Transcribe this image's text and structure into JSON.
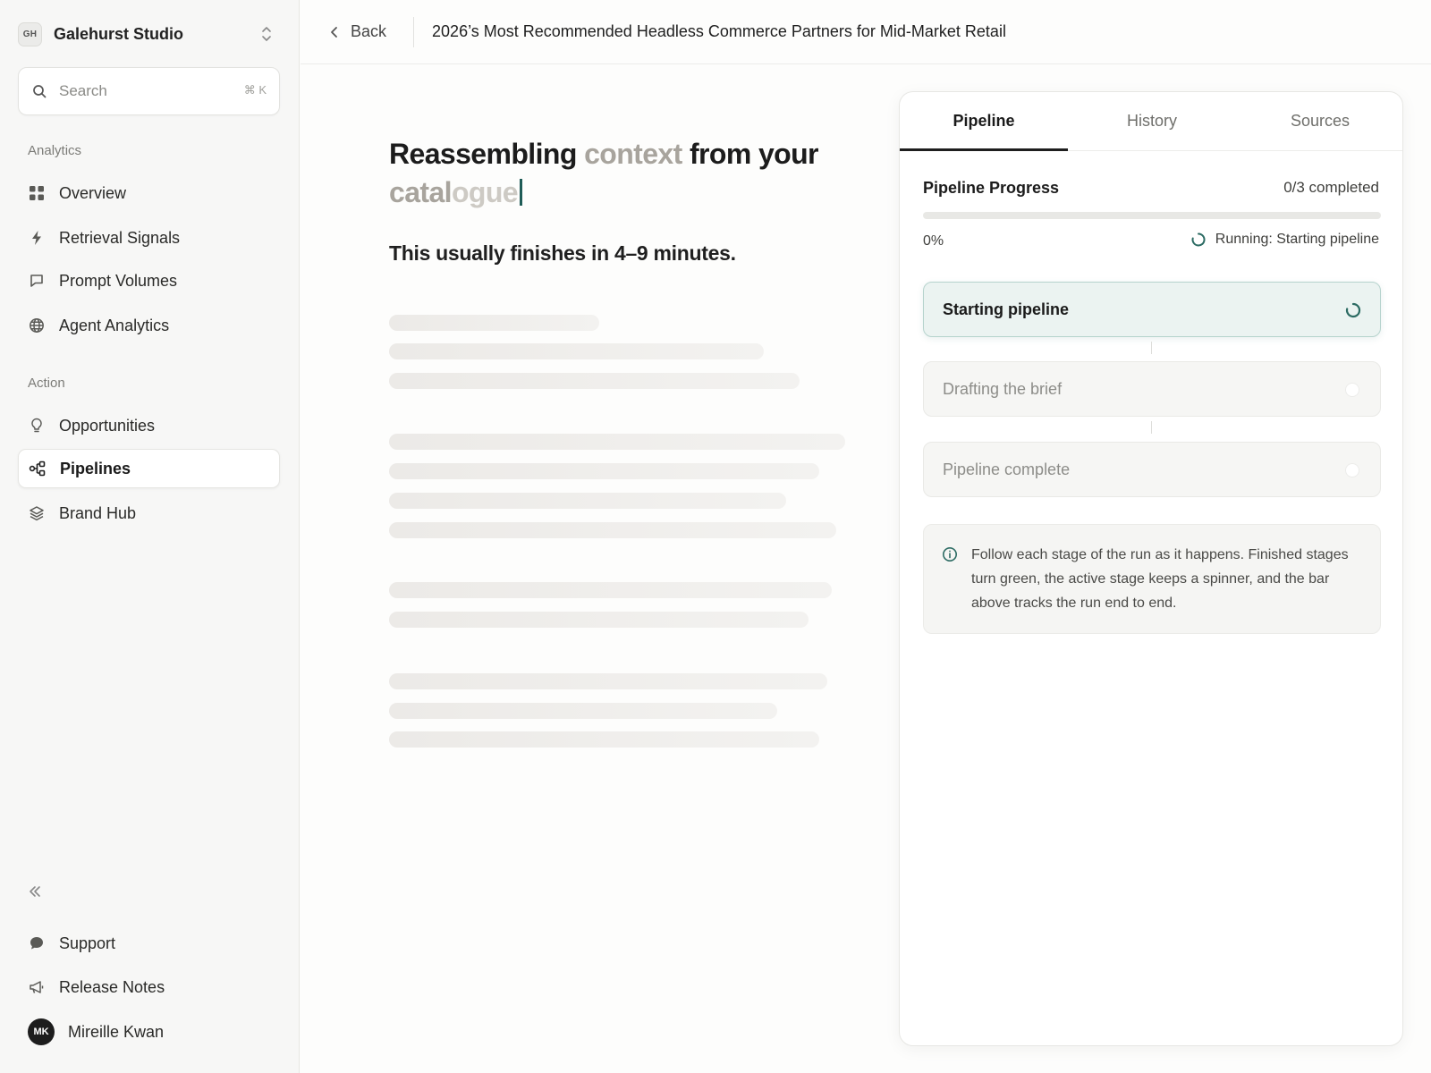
{
  "workspace": {
    "initials": "GH",
    "name": "Galehurst Studio"
  },
  "search": {
    "placeholder": "Search",
    "shortcut": "⌘ K"
  },
  "sidebar": {
    "sections": [
      {
        "label": "Analytics"
      },
      {
        "label": "Action"
      }
    ],
    "items": [
      {
        "label": "Overview",
        "icon": "grid-icon"
      },
      {
        "label": "Retrieval Signals",
        "icon": "bolt-icon"
      },
      {
        "label": "Prompt Volumes",
        "icon": "chat-bubble-icon"
      },
      {
        "label": "Agent Analytics",
        "icon": "globe-icon"
      },
      {
        "label": "Opportunities",
        "icon": "lightbulb-icon"
      },
      {
        "label": "Pipelines",
        "icon": "pipeline-icon",
        "active": true
      },
      {
        "label": "Brand Hub",
        "icon": "layers-icon"
      }
    ],
    "footer": {
      "support": "Support",
      "release_notes": "Release Notes",
      "user_initials": "MK",
      "user_name": "Mireille Kwan"
    }
  },
  "topbar": {
    "back_label": "Back",
    "title": "2026’s Most Recommended Headless Commerce Partners for Mid-Market Retail"
  },
  "main": {
    "headline": {
      "part1": "Reassembling ",
      "part2": "context",
      "part3": " from your ",
      "part4": "catal",
      "part5": "ogue"
    },
    "subhead": "This usually finishes in 4–9 minutes."
  },
  "panel": {
    "tabs": [
      {
        "label": "Pipeline",
        "active": true
      },
      {
        "label": "History"
      },
      {
        "label": "Sources"
      }
    ],
    "progress": {
      "title": "Pipeline Progress",
      "count": "0/3 completed",
      "percent_label": "0%",
      "fraction": 0,
      "status": "Running: Starting pipeline"
    },
    "stages": [
      {
        "label": "Starting pipeline",
        "state": "running"
      },
      {
        "label": "Drafting the brief",
        "state": "pending"
      },
      {
        "label": "Pipeline complete",
        "state": "pending"
      }
    ],
    "info": "Follow each stage of the run as it happens. Finished stages turn green, the active stage keeps a spinner, and the bar above tracks the run end to end."
  },
  "colors": {
    "accent": "#2c6b63",
    "active_stage_bg": "#ebf3f1",
    "caret": "#1f5c57"
  }
}
